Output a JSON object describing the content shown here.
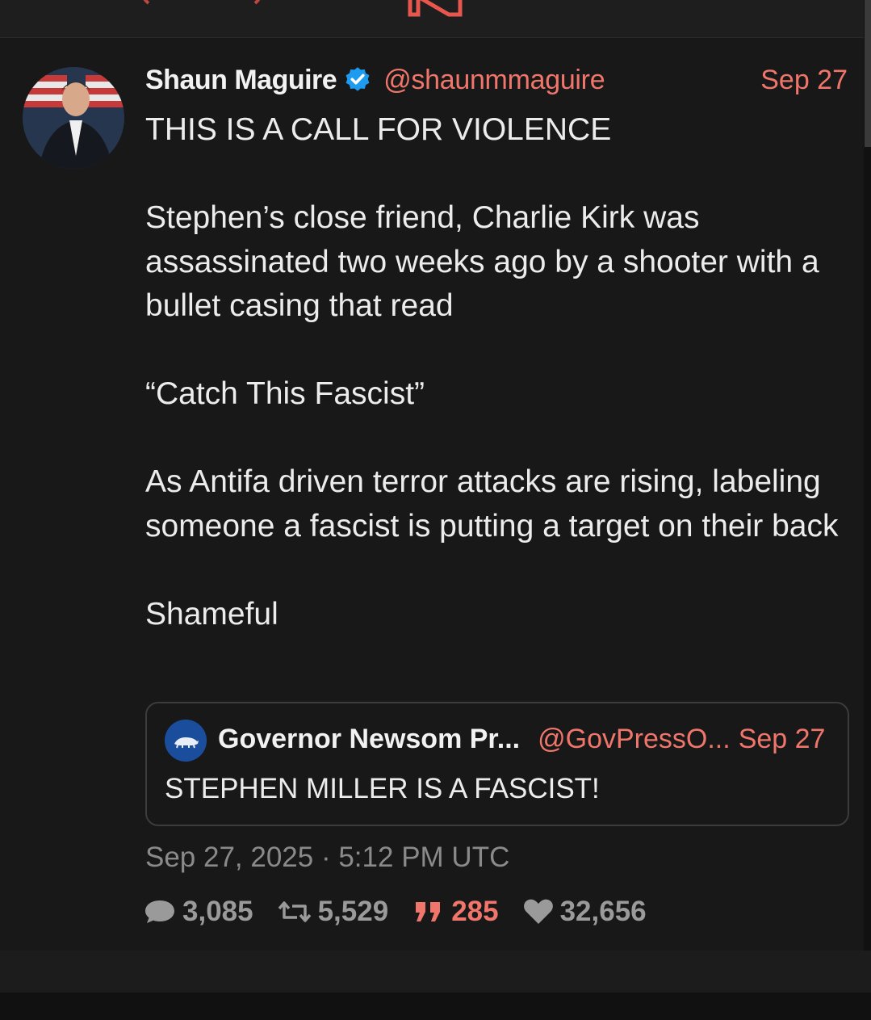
{
  "tweet": {
    "author_name": "Shaun Maguire",
    "handle": "@shaunmmaguire",
    "date": "Sep 27",
    "body": [
      "THIS IS A CALL FOR VIOLENCE",
      "",
      "Stephen’s close friend, Charlie Kirk was assassinated two weeks ago by a shooter with a bullet casing that read",
      "",
      "“Catch This Fascist”",
      "",
      "As Antifa driven terror attacks are rising, labeling someone a fascist is putting a target on their back",
      "",
      "Shameful"
    ],
    "timestamp": "Sep 27, 2025 · 5:12 PM UTC"
  },
  "quoted": {
    "author_name": "Governor Newsom Pr...",
    "handle": "@GovPressO...",
    "date": "Sep 27",
    "text": "STEPHEN MILLER IS A FASCIST!"
  },
  "stats": {
    "replies": "3,085",
    "retweets": "5,529",
    "quotes": "285",
    "likes": "32,656"
  },
  "colors": {
    "accent": "#f0756a",
    "verified": "#1d9bf0",
    "background": "#181818"
  },
  "icons": [
    "nitter-logo-icon",
    "verified-icon",
    "reply-icon",
    "retweet-icon",
    "quote-icon",
    "heart-icon"
  ]
}
